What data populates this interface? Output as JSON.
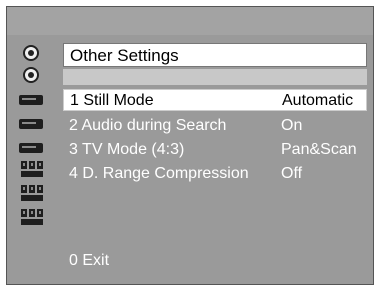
{
  "menu": {
    "title": "Other Settings",
    "items": [
      {
        "label": "1 Still Mode",
        "value": "Automatic",
        "selected": true
      },
      {
        "label": "2 Audio during Search",
        "value": "On",
        "selected": false
      },
      {
        "label": "3 TV Mode (4:3)",
        "value": "Pan&Scan",
        "selected": false
      },
      {
        "label": "4 D. Range Compression",
        "value": "Off",
        "selected": false
      }
    ],
    "exit_label": "0 Exit"
  },
  "sidebar": {
    "icons": [
      "disc-icon",
      "disc-icon",
      "player-icon",
      "player-icon",
      "player-icon",
      "speaker-icon",
      "speaker-icon",
      "speaker-icon"
    ]
  },
  "colors": {
    "background": "#9a9a9a",
    "highlight": "#ffffff",
    "text": "#ffffff"
  }
}
